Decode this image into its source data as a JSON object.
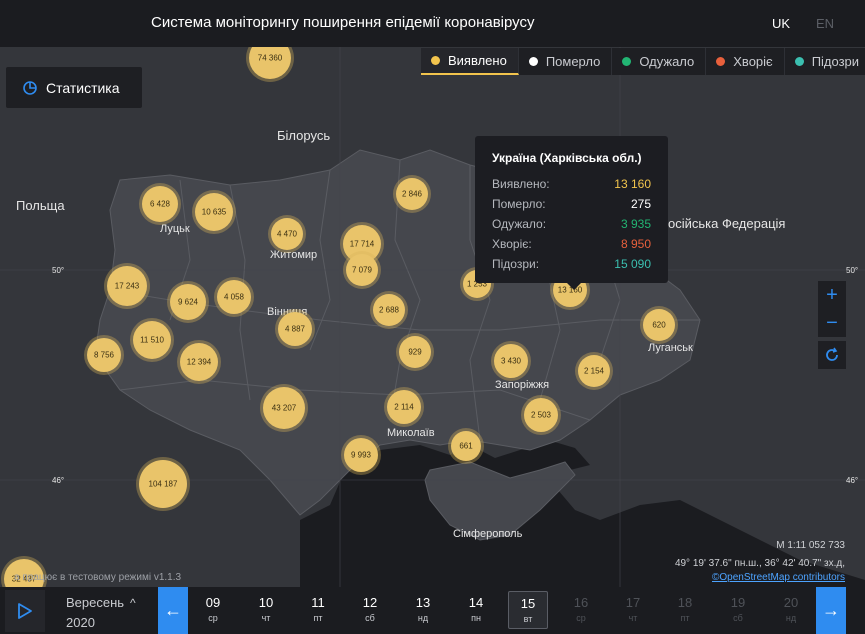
{
  "header": {
    "title": "Система моніторингу поширення епідемії коронавірусу",
    "lang_uk": "UK",
    "lang_en": "EN"
  },
  "stats_button": {
    "label": "Статистика"
  },
  "legend": [
    {
      "label": "Виявлено",
      "color": "#f2c44d",
      "active": true
    },
    {
      "label": "Померло",
      "color": "#ffffff",
      "active": false
    },
    {
      "label": "Одужало",
      "color": "#22b573",
      "active": false
    },
    {
      "label": "Хворіє",
      "color": "#e8603c",
      "active": false
    },
    {
      "label": "Підозри",
      "color": "#3bbfb0",
      "active": false
    }
  ],
  "map": {
    "labels": [
      {
        "text": "Білорусь"
      },
      {
        "text": "Польща"
      },
      {
        "text": "Луцьк"
      },
      {
        "text": "Житомир"
      },
      {
        "text": "Вінниця"
      },
      {
        "text": "Запоріжжя"
      },
      {
        "text": "Луганськ"
      },
      {
        "text": "Миколаїв"
      },
      {
        "text": "Сімферополь"
      },
      {
        "text": "осійська Федерація"
      }
    ],
    "lat_labels": [
      "50°",
      "50°",
      "46°",
      "46°"
    ],
    "clusters": [
      {
        "value": "74 360"
      },
      {
        "value": "6 428"
      },
      {
        "value": "10 635"
      },
      {
        "value": "4 470"
      },
      {
        "value": "17 714"
      },
      {
        "value": "7 079"
      },
      {
        "value": "2 846"
      },
      {
        "value": "17 243"
      },
      {
        "value": "9 624"
      },
      {
        "value": "4 058"
      },
      {
        "value": "4 887"
      },
      {
        "value": "2 688"
      },
      {
        "value": "1 253"
      },
      {
        "value": "13 160"
      },
      {
        "value": "620"
      },
      {
        "value": "11 510"
      },
      {
        "value": "8 756"
      },
      {
        "value": "12 394"
      },
      {
        "value": "929"
      },
      {
        "value": "3 430"
      },
      {
        "value": "2 154"
      },
      {
        "value": "43 207"
      },
      {
        "value": "2 114"
      },
      {
        "value": "2 503"
      },
      {
        "value": "661"
      },
      {
        "value": "9 993"
      },
      {
        "value": "104 187"
      },
      {
        "value": "32 437"
      }
    ]
  },
  "tooltip": {
    "title": "Україна (Харківська обл.)",
    "rows": [
      {
        "label": "Виявлено:",
        "value": "13 160",
        "color": "#f2c44d"
      },
      {
        "label": "Померло:",
        "value": "275",
        "color": "#ffffff"
      },
      {
        "label": "Одужало:",
        "value": "3 935",
        "color": "#22b573"
      },
      {
        "label": "Хворіє:",
        "value": "8 950",
        "color": "#e8603c"
      },
      {
        "label": "Підозри:",
        "value": "15 090",
        "color": "#3bbfb0"
      }
    ]
  },
  "info": {
    "scale": "M 1:11 052 733",
    "coords": "49° 19' 37.6\" пн.ш., 36° 42' 40.7\" зх.д,",
    "osm": "©OpenStreetMap contributors",
    "testmode": "а працює в тестовому режимі v1.1.3"
  },
  "timeline": {
    "month": "Вересень",
    "year": "2020",
    "days": [
      {
        "num": "09",
        "wd": "ср",
        "state": "normal"
      },
      {
        "num": "10",
        "wd": "чт",
        "state": "normal"
      },
      {
        "num": "11",
        "wd": "пт",
        "state": "normal"
      },
      {
        "num": "12",
        "wd": "сб",
        "state": "normal"
      },
      {
        "num": "13",
        "wd": "нд",
        "state": "normal"
      },
      {
        "num": "14",
        "wd": "пн",
        "state": "normal"
      },
      {
        "num": "15",
        "wd": "вт",
        "state": "selected"
      },
      {
        "num": "16",
        "wd": "ср",
        "state": "disabled"
      },
      {
        "num": "17",
        "wd": "чт",
        "state": "disabled"
      },
      {
        "num": "18",
        "wd": "пт",
        "state": "disabled"
      },
      {
        "num": "19",
        "wd": "сб",
        "state": "disabled"
      },
      {
        "num": "20",
        "wd": "нд",
        "state": "disabled"
      }
    ]
  }
}
